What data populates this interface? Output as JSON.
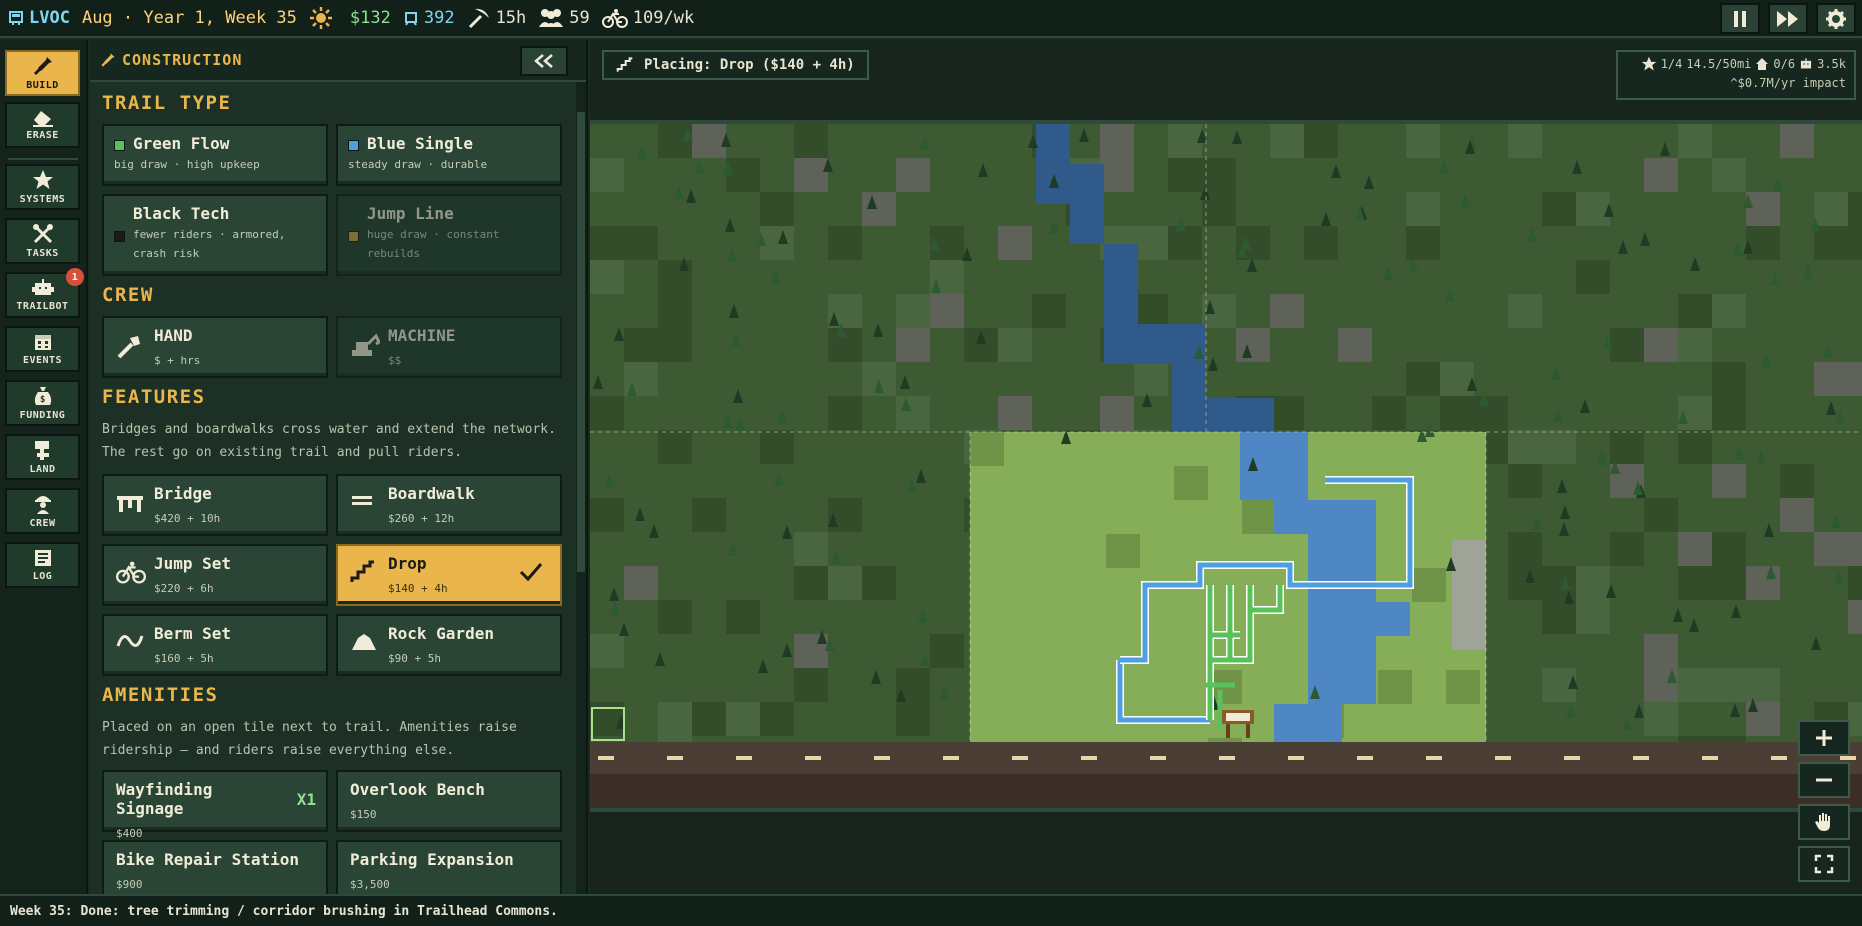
{
  "topbar": {
    "brand": "LVOC",
    "date": "Aug · Year 1, Week 35",
    "money": "$132",
    "riders_text": "392",
    "hours": "15h",
    "crew": "59",
    "visits": "109/wk"
  },
  "tools": [
    {
      "id": "build",
      "label": "BUILD",
      "icon": "shovel-icon",
      "active": true
    },
    {
      "id": "erase",
      "label": "ERASE",
      "icon": "eraser-icon"
    },
    {
      "id": "systems",
      "label": "SYSTEMS",
      "icon": "star-icon"
    },
    {
      "id": "tasks",
      "label": "TASKS",
      "icon": "tools-icon"
    },
    {
      "id": "trailbot",
      "label": "TRAILBOT",
      "icon": "robot-icon",
      "badge": "1"
    },
    {
      "id": "events",
      "label": "EVENTS",
      "icon": "calendar-icon"
    },
    {
      "id": "funding",
      "label": "FUNDING",
      "icon": "money-bag-icon"
    },
    {
      "id": "land",
      "label": "LAND",
      "icon": "sign-icon"
    },
    {
      "id": "crew",
      "label": "CREW",
      "icon": "worker-icon"
    },
    {
      "id": "log",
      "label": "LOG",
      "icon": "log-icon"
    }
  ],
  "panel": {
    "title": "CONSTRUCTION",
    "trail_type_heading": "TRAIL TYPE",
    "trail_types": [
      {
        "name": "Green Flow",
        "sub": "big draw · high upkeep",
        "color": "#58c15a"
      },
      {
        "name": "Blue Single",
        "sub": "steady draw · durable",
        "color": "#4e9fe0"
      },
      {
        "name": "Black Tech",
        "sub": "fewer riders · armored, crash risk",
        "color": "#1a1a1a"
      },
      {
        "name": "Jump Line",
        "sub": "huge draw · constant rebuilds",
        "color": "#c8a640",
        "disabled": true
      }
    ],
    "crew_heading": "CREW",
    "crew": [
      {
        "name": "HAND",
        "sub": "$ + hrs"
      },
      {
        "name": "MACHINE",
        "sub": "$$",
        "disabled": true
      }
    ],
    "features_heading": "FEATURES",
    "features_desc": "Bridges and boardwalks cross water and extend the network. The rest go on existing trail and pull riders.",
    "features": [
      {
        "name": "Bridge",
        "sub": "$420 + 10h"
      },
      {
        "name": "Boardwalk",
        "sub": "$260 + 12h"
      },
      {
        "name": "Jump Set",
        "sub": "$220 + 6h"
      },
      {
        "name": "Drop",
        "sub": "$140 + 4h",
        "selected": true
      },
      {
        "name": "Berm Set",
        "sub": "$160 + 5h"
      },
      {
        "name": "Rock Garden",
        "sub": "$90 + 5h"
      }
    ],
    "amenities_heading": "AMENITIES",
    "amenities_desc": "Placed on an open tile next to trail. Amenities raise ridership — and riders raise everything else.",
    "amenities": [
      {
        "name": "Wayfinding Signage",
        "badge": "X1",
        "sub": "$400"
      },
      {
        "name": "Overlook Bench",
        "sub": "$150"
      },
      {
        "name": "Bike Repair Station",
        "sub": "$900"
      },
      {
        "name": "Parking Expansion",
        "sub": "$3,500"
      }
    ]
  },
  "map": {
    "placing": "Placing: Drop ($140 + 4h)",
    "stats_stars": "1/4",
    "stats_miles": "14.5/50mi",
    "stats_houses": "0/6",
    "stats_riders": "3.5k",
    "stats_impact": "^$0.7M/yr impact"
  },
  "status": {
    "message": "Week 35: Done: tree trimming / corridor brushing in Trailhead Commons."
  }
}
